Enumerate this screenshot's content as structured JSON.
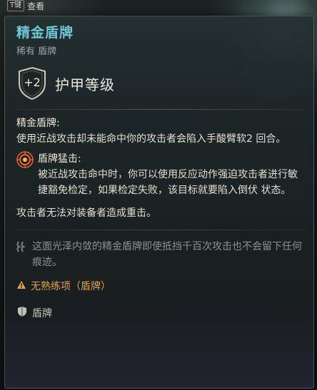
{
  "hotkey": {
    "key": "T键",
    "label": "查看"
  },
  "item": {
    "name": "精金盾牌",
    "rarity": "稀有",
    "category": "盾牌",
    "armor_bonus": "+2",
    "armor_label": "护甲等级"
  },
  "passive": {
    "name": "精金盾牌:",
    "description": "使用近战攻击却未能命中你的攻击者会陷入手酸臂软2 回合。"
  },
  "reaction": {
    "icon": "shield-bash-icon",
    "title": "盾牌猛击:",
    "description": "被近战攻击命中时，你可以使用反应动作强迫攻击者进行敏捷豁免检定，如果检定失败，该目标就要陷入倒伏 状态。"
  },
  "crit_note": "攻击者无法对装备者造成重击。",
  "flavor_text": "这面光泽内敛的精金盾牌即使抵挡千百次攻击也不会留下任何痕迹。",
  "proficiency": {
    "icon": "warning-icon",
    "text": "无熟练项（盾牌）",
    "color": "#e0a24a"
  },
  "item_type": {
    "icon": "shield-type-icon",
    "label": "盾牌"
  },
  "colors": {
    "title": "#6fc6d6",
    "body_text": "#e3dfd4",
    "flavor": "#8e918e"
  }
}
